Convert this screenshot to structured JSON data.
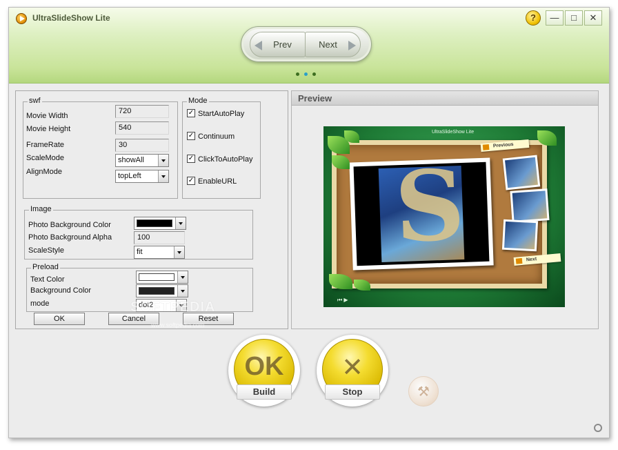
{
  "app": {
    "title": "UltraSlideShow Lite",
    "help_glyph": "?",
    "minimize_glyph": "—",
    "maximize_glyph": "□",
    "close_glyph": "✕"
  },
  "nav": {
    "prev_label": "Prev",
    "next_label": "Next",
    "page_dots": 3,
    "active_dot": 2
  },
  "swf": {
    "legend": "swf",
    "movie_width_label": "Movie Width",
    "movie_width": "720",
    "movie_height_label": "Movie Height",
    "movie_height": "540",
    "framerate_label": "FrameRate",
    "framerate": "30",
    "scalemode_label": "ScaleMode",
    "scalemode": "showAll",
    "alignmode_label": "AlignMode",
    "alignmode": "topLeft"
  },
  "mode": {
    "legend": "Mode",
    "options": [
      {
        "label": "StartAutoPlay",
        "checked": true
      },
      {
        "label": "Continuum",
        "checked": true
      },
      {
        "label": "ClickToAutoPlay",
        "checked": true
      },
      {
        "label": "EnableURL",
        "checked": true
      }
    ]
  },
  "image": {
    "legend": "Image",
    "bg_color_label": "Photo Background Color",
    "bg_color": "#000000",
    "bg_alpha_label": "Photo Background Alpha",
    "bg_alpha": "100",
    "scalestyle_label": "ScaleStyle",
    "scalestyle": "fit"
  },
  "preload": {
    "legend": "Preload",
    "text_color_label": "Text Color",
    "text_color": "#ffffff",
    "bg_color_label": "Background Color",
    "bg_color": "#222222",
    "mode_label": "mode",
    "mode": "dot2"
  },
  "buttons": {
    "ok": "OK",
    "cancel": "Cancel",
    "reset": "Reset"
  },
  "preview": {
    "header": "Preview",
    "stage_title": "UltraSlideShow Lite",
    "previous_tag": "Previous",
    "next_tag": "Next",
    "controls": "⏮ ▶"
  },
  "actions": {
    "build_label": "Build",
    "build_glyph": "OK",
    "stop_label": "Stop",
    "stop_glyph": "✕",
    "tools_glyph": "⚒"
  },
  "watermark": {
    "text": "SOFTPEDIA",
    "url": "www.softpedia.com"
  },
  "colors": {
    "titlebar_green": "#c9e49a",
    "build_yellow": "#f4dc30",
    "active_dot": "#2aa0c8"
  }
}
